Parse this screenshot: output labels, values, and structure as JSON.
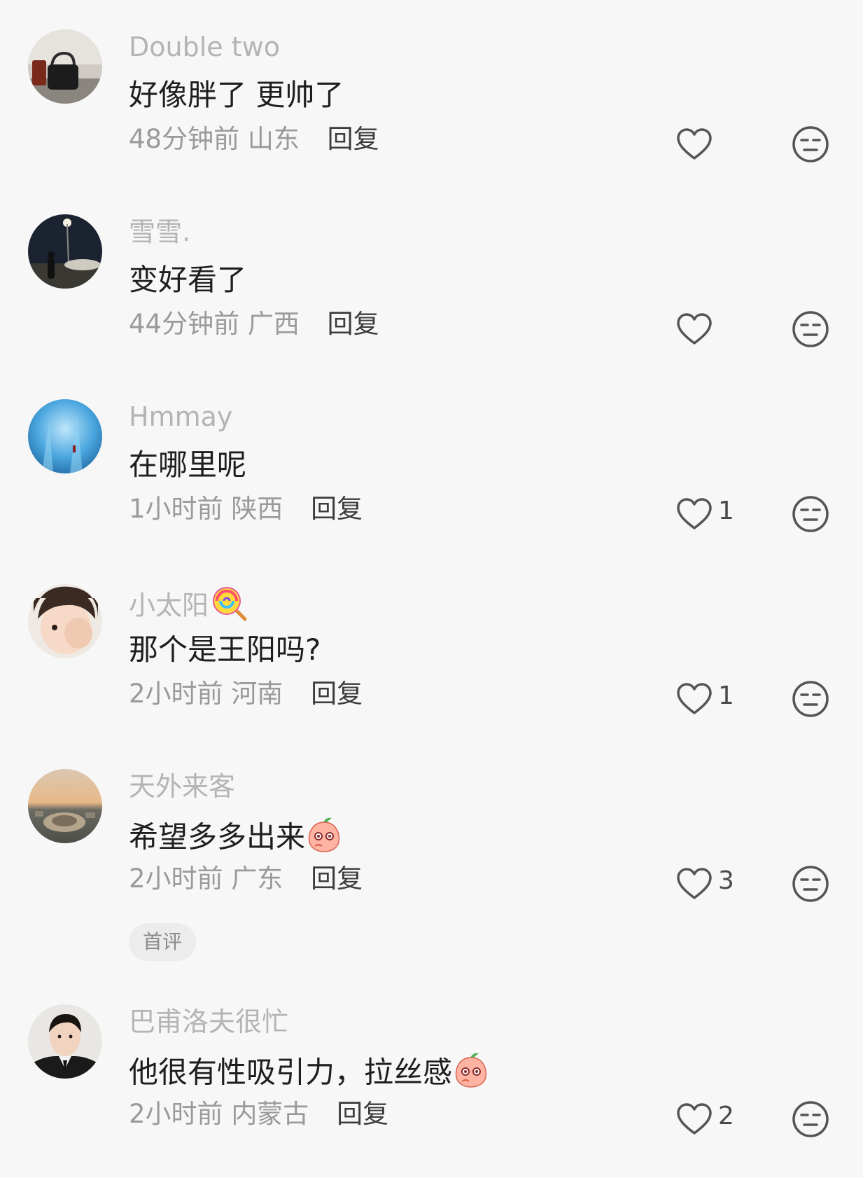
{
  "comments": [
    {
      "username": "Double two",
      "text": "好像胖了 更帅了",
      "time": "48分钟前",
      "location": "山东",
      "reply": "回复",
      "likes": "",
      "avatar": "handbag-photo-avatar"
    },
    {
      "username": "雪雪.",
      "text": "变好看了",
      "time": "44分钟前",
      "location": "广西",
      "reply": "回复",
      "likes": "",
      "avatar": "night-street-avatar"
    },
    {
      "username": "Hmmay",
      "text": "在哪里呢",
      "time": "1小时前",
      "location": "陕西",
      "reply": "回复",
      "likes": "1",
      "avatar": "blue-water-avatar"
    },
    {
      "username": "小太阳",
      "text": "那个是王阳吗?",
      "time": "2小时前",
      "location": "河南",
      "reply": "回复",
      "likes": "1",
      "avatar": "child-photo-avatar",
      "username_emoji": "lollipop-emoji"
    },
    {
      "username": "天外来客",
      "text": "希望多多出来",
      "time": "2小时前",
      "location": "广东",
      "reply": "回复",
      "likes": "3",
      "avatar": "aerial-town-avatar",
      "text_emoji": "peach-blush-emoji",
      "badge": "首评"
    },
    {
      "username": "巴甫洛夫很忙",
      "text": "他很有性吸引力，拉丝感",
      "time": "2小时前",
      "location": "内蒙古",
      "reply": "回复",
      "likes": "2",
      "avatar": "man-suit-avatar",
      "text_emoji": "peach-blush-emoji"
    }
  ],
  "colors": {
    "background": "#f7f7f7",
    "username": "#b4b4b4",
    "text": "#1e1e1e",
    "meta": "#9a9a9a",
    "reply": "#3c3c3c",
    "icon": "#555555"
  }
}
